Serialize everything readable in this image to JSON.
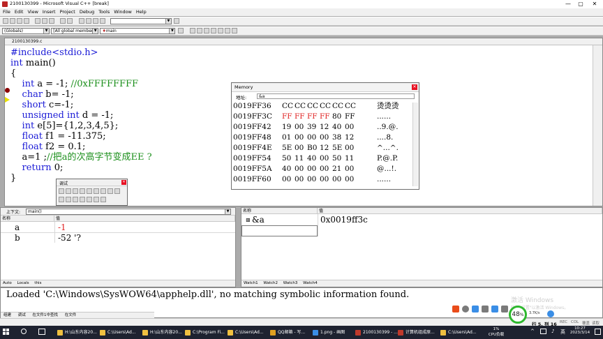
{
  "window": {
    "title": "2100130399 - Microsoft Visual C++ [break]",
    "controls": [
      "—",
      "▢",
      "✕"
    ]
  },
  "menu": [
    "File",
    "Edit",
    "View",
    "Insert",
    "Project",
    "Debug",
    "Tools",
    "Window",
    "Help"
  ],
  "toolbar2": {
    "globals": "(Globals)",
    "members": "[All global members]",
    "function": "main"
  },
  "editor": {
    "tab_title": "2100130399.c",
    "lines": [
      {
        "parts": [
          {
            "t": "#include<stdio.h>",
            "c": "kw"
          }
        ]
      },
      {
        "parts": [
          {
            "t": "int",
            "c": "kw"
          },
          {
            "t": " main()",
            "c": ""
          }
        ]
      },
      {
        "parts": [
          {
            "t": "{",
            "c": ""
          }
        ]
      },
      {
        "parts": [
          {
            "t": "    ",
            "c": ""
          },
          {
            "t": "int",
            "c": "kw"
          },
          {
            "t": " a = -1; ",
            "c": ""
          },
          {
            "t": "//0xFFFFFFFF",
            "c": "cm"
          }
        ]
      },
      {
        "parts": [
          {
            "t": "    ",
            "c": ""
          },
          {
            "t": "char",
            "c": "kw"
          },
          {
            "t": " b= -1;",
            "c": ""
          }
        ]
      },
      {
        "parts": [
          {
            "t": "    ",
            "c": ""
          },
          {
            "t": "short",
            "c": "kw"
          },
          {
            "t": " c=-1;",
            "c": ""
          }
        ]
      },
      {
        "parts": [
          {
            "t": "    ",
            "c": ""
          },
          {
            "t": "unsigned",
            "c": "kw"
          },
          {
            "t": " ",
            "c": ""
          },
          {
            "t": "int",
            "c": "kw"
          },
          {
            "t": " d = -1;",
            "c": ""
          }
        ]
      },
      {
        "parts": [
          {
            "t": "    ",
            "c": ""
          },
          {
            "t": "int",
            "c": "kw"
          },
          {
            "t": " e[5]={1,2,3,4,5};",
            "c": ""
          }
        ]
      },
      {
        "parts": [
          {
            "t": "    ",
            "c": ""
          },
          {
            "t": "float",
            "c": "kw"
          },
          {
            "t": " f1 = -11.375;",
            "c": ""
          }
        ]
      },
      {
        "parts": [
          {
            "t": "    ",
            "c": ""
          },
          {
            "t": "float",
            "c": "kw"
          },
          {
            "t": " f2 = 0.1;",
            "c": ""
          }
        ]
      },
      {
        "parts": [
          {
            "t": "    a=1 ;",
            "c": ""
          },
          {
            "t": "//把a的次高字节变成EE ?",
            "c": "cm"
          }
        ]
      },
      {
        "parts": [
          {
            "t": "    ",
            "c": ""
          },
          {
            "t": "return",
            "c": "kw"
          },
          {
            "t": " 0;",
            "c": ""
          }
        ]
      },
      {
        "parts": [
          {
            "t": "}",
            "c": ""
          }
        ]
      }
    ]
  },
  "memory": {
    "title": "Memory",
    "address_label": "地址:",
    "address_value": "&a",
    "rows": [
      {
        "addr": "0019FF36",
        "bytes": [
          "CC",
          "CC",
          "CC",
          "CC",
          "CC",
          "CC"
        ],
        "red": [],
        "ascii": "烫烫烫"
      },
      {
        "addr": "0019FF3C",
        "bytes": [
          "FF",
          "FF",
          "FF",
          "FF",
          "80",
          "FF"
        ],
        "red": [
          0,
          1,
          2,
          3
        ],
        "ascii": "......"
      },
      {
        "addr": "0019FF42",
        "bytes": [
          "19",
          "00",
          "39",
          "12",
          "40",
          "00"
        ],
        "red": [],
        "ascii": "..9.@."
      },
      {
        "addr": "0019FF48",
        "bytes": [
          "01",
          "00",
          "00",
          "00",
          "38",
          "12"
        ],
        "red": [],
        "ascii": "....8."
      },
      {
        "addr": "0019FF4E",
        "bytes": [
          "5E",
          "00",
          "B0",
          "12",
          "5E",
          "00"
        ],
        "red": [],
        "ascii": "^...^."
      },
      {
        "addr": "0019FF54",
        "bytes": [
          "50",
          "11",
          "40",
          "00",
          "50",
          "11"
        ],
        "red": [],
        "ascii": "P.@.P."
      },
      {
        "addr": "0019FF5A",
        "bytes": [
          "40",
          "00",
          "00",
          "00",
          "21",
          "00"
        ],
        "red": [],
        "ascii": "@...!."
      },
      {
        "addr": "0019FF60",
        "bytes": [
          "00",
          "00",
          "00",
          "00",
          "00",
          "00"
        ],
        "red": [],
        "ascii": "......"
      }
    ]
  },
  "debug_toolbar": {
    "title": "调试"
  },
  "variables": {
    "context_label": "上下文:",
    "context_value": "main()",
    "col_name": "名称",
    "col_value": "值",
    "rows": [
      {
        "name": "a",
        "value": "-1",
        "changed": true
      },
      {
        "name": "b",
        "value": "-52 '?",
        "changed": false
      }
    ],
    "tabs": [
      "Auto",
      "Locals",
      "this"
    ]
  },
  "watch": {
    "col_name": "名称",
    "col_value": "值",
    "rows": [
      {
        "name": "&a",
        "value": "0x0019ff3c",
        "expand": "⊞"
      }
    ],
    "tabs": [
      "Watch1",
      "Watch2",
      "Watch3",
      "Watch4"
    ]
  },
  "output": {
    "text": "Loaded 'C:\\Windows\\SysWOW64\\apphelp.dll', no matching symbolic information found.",
    "tabs": [
      "组建",
      "调试",
      "在文件1中查找",
      "在文件"
    ]
  },
  "status": {
    "position": "行 5, 列 16",
    "indicators": [
      "REC",
      "COL",
      "覆盖",
      "读取"
    ]
  },
  "watermark": {
    "line1": "激活 Windows",
    "line2": "转到\"设置\"以激活 Windows。"
  },
  "gauge": {
    "percent": "48",
    "unit": "%",
    "speed": "3.7K/s"
  },
  "taskbar": {
    "items": [
      {
        "label": "H:\\山东内容20...",
        "color": "#f0c040"
      },
      {
        "label": "C:\\Users\\Ad...",
        "color": "#f0c040"
      },
      {
        "label": "H:\\山东内容20...",
        "color": "#f0c040"
      },
      {
        "label": "C:\\Program Fi...",
        "color": "#f0c040"
      },
      {
        "label": "C:\\Users\\Ad...",
        "color": "#f0c040"
      },
      {
        "label": "QQ邮箱 - 写...",
        "color": "#e0a020"
      },
      {
        "label": "1.png - 画图",
        "color": "#3a8ee6"
      },
      {
        "label": "2100130399 - ...",
        "color": "#c0392b"
      },
      {
        "label": "计算机组成原...",
        "color": "#c0392b"
      },
      {
        "label": "C:\\Users\\Ad...",
        "color": "#f0c040"
      }
    ],
    "cpu": "1%",
    "cpu_label": "CPU负载",
    "time": "10:27",
    "date": "2023/3/14",
    "lang": "英"
  }
}
